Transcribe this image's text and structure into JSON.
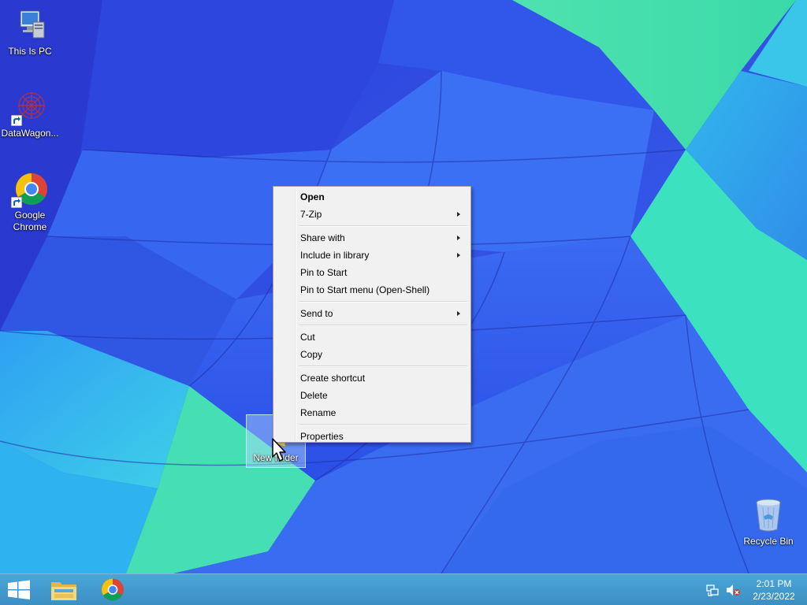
{
  "desktop": {
    "icons": [
      {
        "label": "This Is PC",
        "icon": "computer-icon"
      },
      {
        "label": "DataWagon...",
        "icon": "datawagon-icon"
      },
      {
        "label": "Google\nChrome",
        "icon": "chrome-icon"
      },
      {
        "label": "New folder",
        "icon": "folder-icon"
      },
      {
        "label": "Recycle Bin",
        "icon": "recycle-bin-icon"
      }
    ]
  },
  "context_menu": {
    "items": {
      "open": "Open",
      "seven_zip": "7-Zip",
      "share_with": "Share with",
      "include_in_library": "Include in library",
      "pin_to_start": "Pin to Start",
      "pin_to_start_menu": "Pin to Start menu (Open-Shell)",
      "send_to": "Send to",
      "cut": "Cut",
      "copy": "Copy",
      "create_shortcut": "Create shortcut",
      "delete": "Delete",
      "rename": "Rename",
      "properties": "Properties"
    }
  },
  "taskbar": {
    "buttons": [
      "windows-logo-icon",
      "file-explorer-icon",
      "chrome-icon"
    ],
    "tray": [
      "network-icon",
      "volume-muted-icon"
    ],
    "clock": {
      "time": "2:01 PM",
      "date": "2/23/2022"
    }
  },
  "colors": {
    "accent_taskbar": "#3b8fc4",
    "menu_background": "#f1f1f1"
  }
}
